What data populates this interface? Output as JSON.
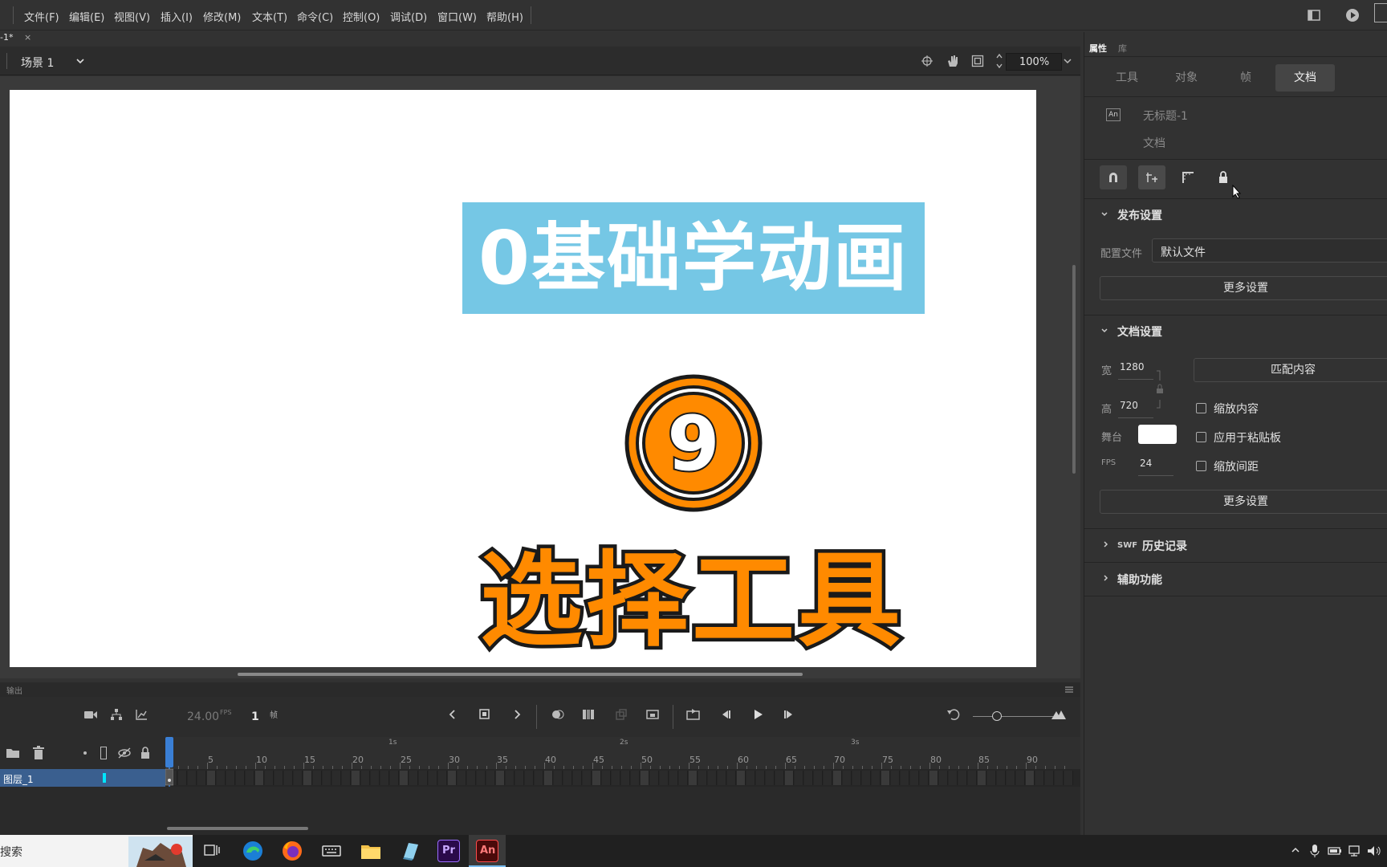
{
  "menu": {
    "items": [
      "文件(F)",
      "编辑(E)",
      "视图(V)",
      "插入(I)",
      "修改(M)",
      "文本(T)",
      "命令(C)",
      "控制(O)",
      "调试(D)",
      "窗口(W)",
      "帮助(H)"
    ]
  },
  "doc_tab": {
    "title": "-1*",
    "close": "×"
  },
  "scene": {
    "label": "场景 1",
    "zoom": "100%"
  },
  "stage": {
    "title": "0基础学动画",
    "number": "9",
    "subtitle": "选择工具",
    "banner_color": "#75c7e5",
    "accent_color": "#ff8a00"
  },
  "output": {
    "label": "输出"
  },
  "timeline": {
    "fps": "24.00",
    "fps_unit": "FPS",
    "frame": "1",
    "frame_unit": "帧",
    "seconds": [
      "1s",
      "2s",
      "3s"
    ],
    "ruler": [
      "5",
      "10",
      "15",
      "20",
      "25",
      "30",
      "35",
      "40",
      "45",
      "50",
      "55",
      "60",
      "65",
      "70",
      "75",
      "80",
      "85",
      "90"
    ],
    "layer_name": "图层_1"
  },
  "panel": {
    "top_tabs": [
      "属性",
      "库"
    ],
    "tabs": [
      "工具",
      "对象",
      "帧",
      "文档"
    ],
    "doc_name": "无标题-1",
    "doc_type": "文档",
    "publish": {
      "header": "发布设置",
      "profile_label": "配置文件",
      "profile_value": "默认文件",
      "more": "更多设置"
    },
    "doc_settings": {
      "header": "文档设置",
      "width_label": "宽",
      "width": "1280",
      "height_label": "高",
      "height": "720",
      "match": "匹配内容",
      "stage_label": "舞台",
      "fps_label": "FPS",
      "fps": "24",
      "scale_content": "缩放内容",
      "apply_paste": "应用于粘贴板",
      "scale_spacing": "缩放间距",
      "more": "更多设置"
    },
    "swf": {
      "prefix": "SWF",
      "label": "历史记录"
    },
    "accessibility": "辅助功能"
  },
  "taskbar": {
    "search": "搜索"
  }
}
